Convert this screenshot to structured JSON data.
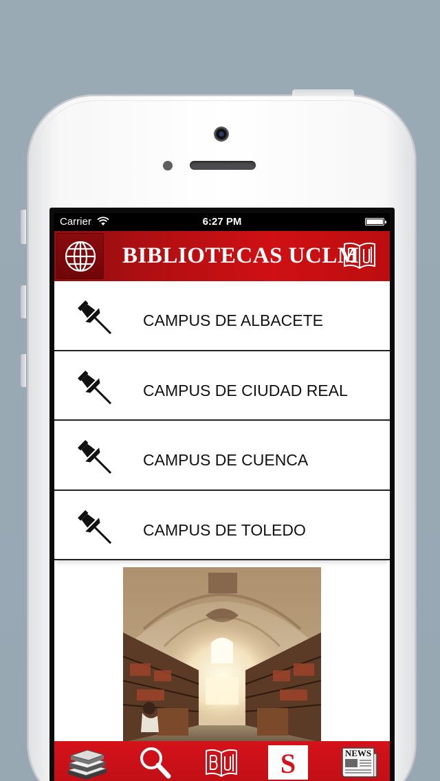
{
  "status_bar": {
    "carrier": "Carrier",
    "time": "6:27 PM"
  },
  "header": {
    "title": "BIBLIOTECAS UCLM",
    "globe_icon": "globe-icon",
    "logo_icon": "library-book-logo-icon"
  },
  "campuses": [
    {
      "label": "CAMPUS DE ALBACETE",
      "icon": "pushpin-icon"
    },
    {
      "label": "CAMPUS DE CIUDAD REAL",
      "icon": "pushpin-icon"
    },
    {
      "label": "CAMPUS DE CUENCA",
      "icon": "pushpin-icon"
    },
    {
      "label": "CAMPUS DE TOLEDO",
      "icon": "pushpin-icon"
    }
  ],
  "tab_bar": {
    "tabs": [
      {
        "icon": "books-stack-icon"
      },
      {
        "icon": "magnifier-search-icon"
      },
      {
        "icon": "library-book-logo-icon"
      },
      {
        "icon": "s-badge-icon",
        "text": "S"
      },
      {
        "icon": "newspaper-icon",
        "text": "NEWS"
      }
    ]
  },
  "colors": {
    "brand_red": "#cf1014",
    "dark_red": "#8d0e10",
    "tab_bar_red": "#d5121a"
  }
}
